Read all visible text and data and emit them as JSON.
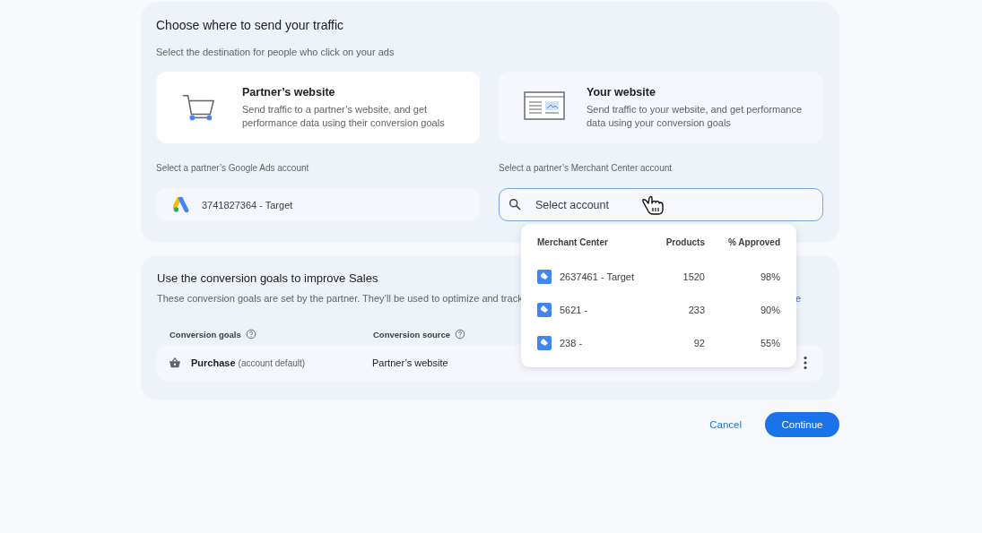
{
  "traffic": {
    "title": "Choose where to send your traffic",
    "subtitle": "Select the destination for people who click on your ads",
    "destinations": [
      {
        "kind": "cart",
        "title": "Partner’s website",
        "description": "Send traffic to a partner’s website, and get performance data using their conversion goals",
        "selected": true
      },
      {
        "kind": "webpage",
        "title": "Your website",
        "description": "Send traffic to your website, and get performance data using your conversion goals",
        "selected": false
      }
    ],
    "ads_account": {
      "label": "Select a partner’s Google Ads account",
      "value": "3741827364 - Target"
    },
    "merchant_account": {
      "label": "Select a partner’s Merchant Center account",
      "placeholder": "Select account"
    }
  },
  "merchant_dropdown": {
    "columns": [
      "Merchant Center",
      "Products",
      "% Approved"
    ],
    "rows": [
      {
        "name": "2637461 - Target",
        "products": "1520",
        "approved": "98%"
      },
      {
        "name": "5621 -",
        "products": "233",
        "approved": "90%"
      },
      {
        "name": "238 -",
        "products": "92",
        "approved": "55%"
      }
    ]
  },
  "goals": {
    "title": "Use the conversion goals to improve Sales",
    "description": "These conversion goals are set by the partner. They’ll be used to optimize and track",
    "link": "e",
    "columns": [
      "Conversion goals",
      "Conversion source"
    ],
    "rows": [
      {
        "goal": "Purchase",
        "note": "(account default)",
        "source": "Partner’s website"
      }
    ]
  },
  "buttons": {
    "cancel": "Cancel",
    "continue": "Continue"
  }
}
